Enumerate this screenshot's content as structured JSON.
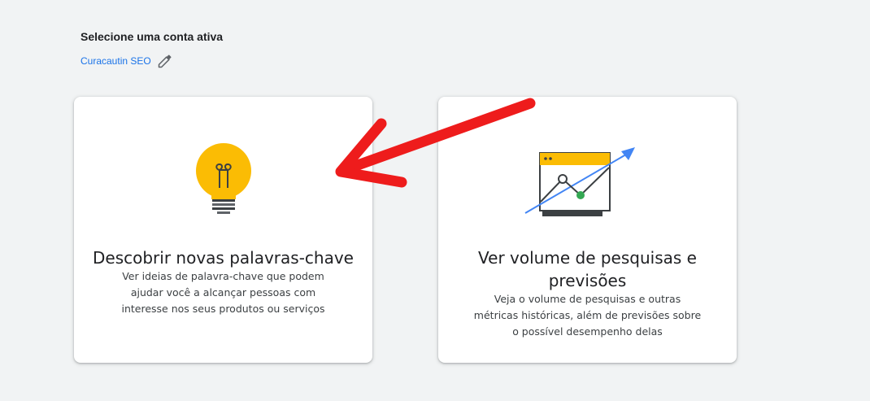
{
  "header": {
    "title": "Selecione uma conta ativa",
    "account_name": "Curacautin SEO",
    "edit_icon": "pencil-icon"
  },
  "cards": [
    {
      "title": "Descobrir novas palavras-chave",
      "description": "Ver ideias de palavra-chave que podem ajudar você a alcançar pessoas com interesse nos seus produtos ou serviços",
      "icon": "lightbulb-icon"
    },
    {
      "title": "Ver volume de pesquisas e previsões",
      "description": "Veja o volume de pesquisas e outras métricas históricas, além de previsões sobre o possível desempenho delas",
      "icon": "trend-chart-icon"
    }
  ],
  "annotation": {
    "icon": "red-arrow-icon",
    "color": "#ee1c1c"
  },
  "colors": {
    "background": "#f1f3f4",
    "link": "#1a73e8",
    "bulb_yellow": "#fbbc04",
    "chart_arrow_blue": "#4285f4",
    "chart_point_green": "#34a853"
  }
}
